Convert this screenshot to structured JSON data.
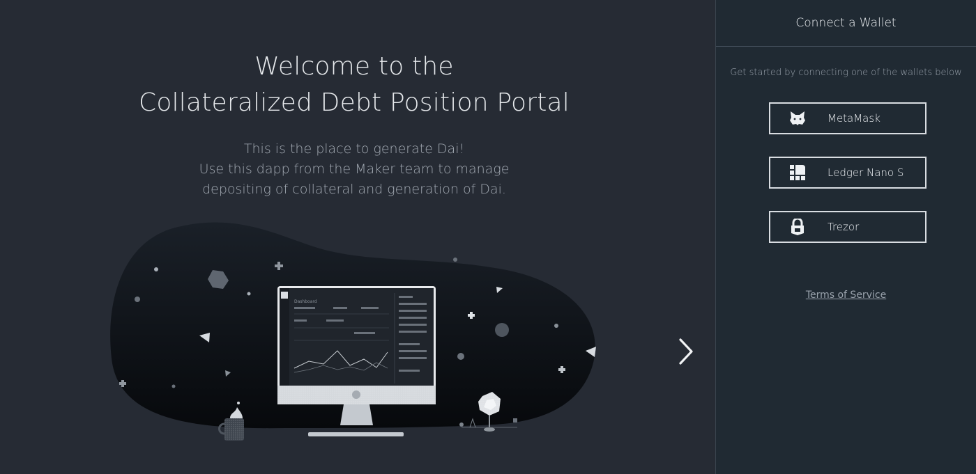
{
  "hero": {
    "title_line1": "Welcome to the",
    "title_line2": "Collateralized Debt Position Portal",
    "subtitle_line1": "This is the place to generate Dai!",
    "subtitle_line2": "Use this dapp from the Maker team to manage",
    "subtitle_line3": "depositing of collateral and generation of Dai."
  },
  "illustration": {
    "screen_title": "Dashboard"
  },
  "navigation": {
    "next_icon": "chevron-right-icon"
  },
  "sidebar": {
    "title": "Connect a Wallet",
    "intro": "Get started by connecting one of the wallets below",
    "wallets": [
      {
        "label": "MetaMask",
        "icon": "fox-icon"
      },
      {
        "label": "Ledger Nano S",
        "icon": "ledger-icon"
      },
      {
        "label": "Trezor",
        "icon": "lock-icon"
      }
    ],
    "terms_label": "Terms of Service"
  },
  "colors": {
    "background": "#262b34",
    "sidebar_background": "#202a33",
    "text_primary": "#eef1f4",
    "text_muted": "#9aa3ad"
  }
}
